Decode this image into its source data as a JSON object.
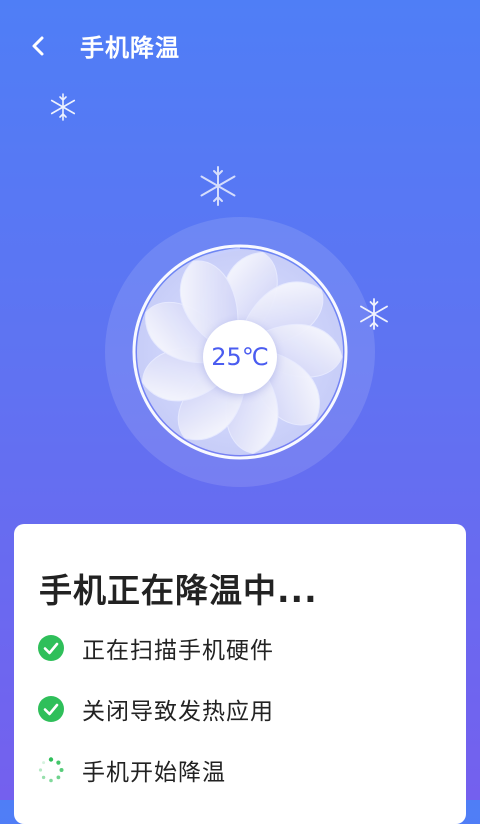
{
  "header": {
    "title": "手机降温"
  },
  "fan": {
    "temperature": "25℃"
  },
  "card": {
    "title": "手机正在降温中...",
    "steps": [
      {
        "label": "正在扫描手机硬件",
        "status": "done"
      },
      {
        "label": "关闭导致发热应用",
        "status": "done"
      },
      {
        "label": "手机开始降温",
        "status": "loading"
      }
    ]
  },
  "colors": {
    "accent": "#4a5cf0",
    "check": "#2fbf5a",
    "bg_top": "#4f7ef6",
    "bg_bottom": "#7460ee"
  }
}
